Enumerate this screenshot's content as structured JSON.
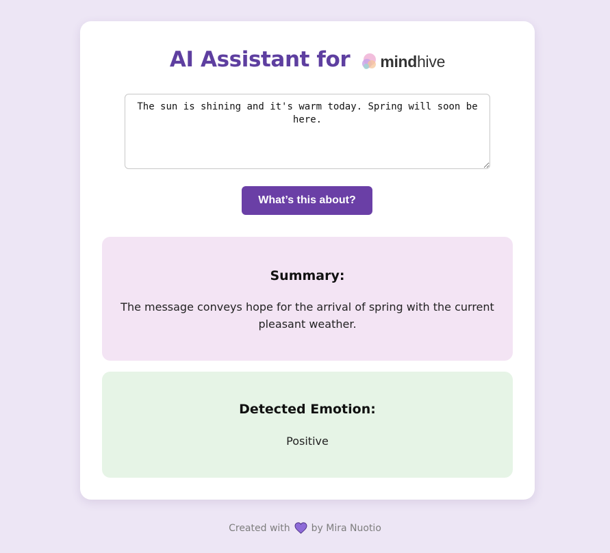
{
  "header": {
    "title": "AI Assistant for",
    "logo_text_bold": "mind",
    "logo_text_light": "hive"
  },
  "input": {
    "value": "The sun is shining and it's warm today. Spring will soon be here."
  },
  "action": {
    "button_label": "What’s this about?"
  },
  "summary": {
    "heading": "Summary:",
    "text": "The message conveys hope for the arrival of spring with the current pleasant weather."
  },
  "emotion": {
    "heading": "Detected Emotion:",
    "value": "Positive"
  },
  "footer": {
    "prefix": "Created with",
    "suffix": "by Mira Nuotio",
    "icon": "heart-icon"
  },
  "colors": {
    "accent": "#6a3fa6",
    "title": "#5e3fa0",
    "summary_bg": "#f3e4f4",
    "emotion_bg": "#e6f4e6",
    "page_bg": "#ede6f5"
  }
}
